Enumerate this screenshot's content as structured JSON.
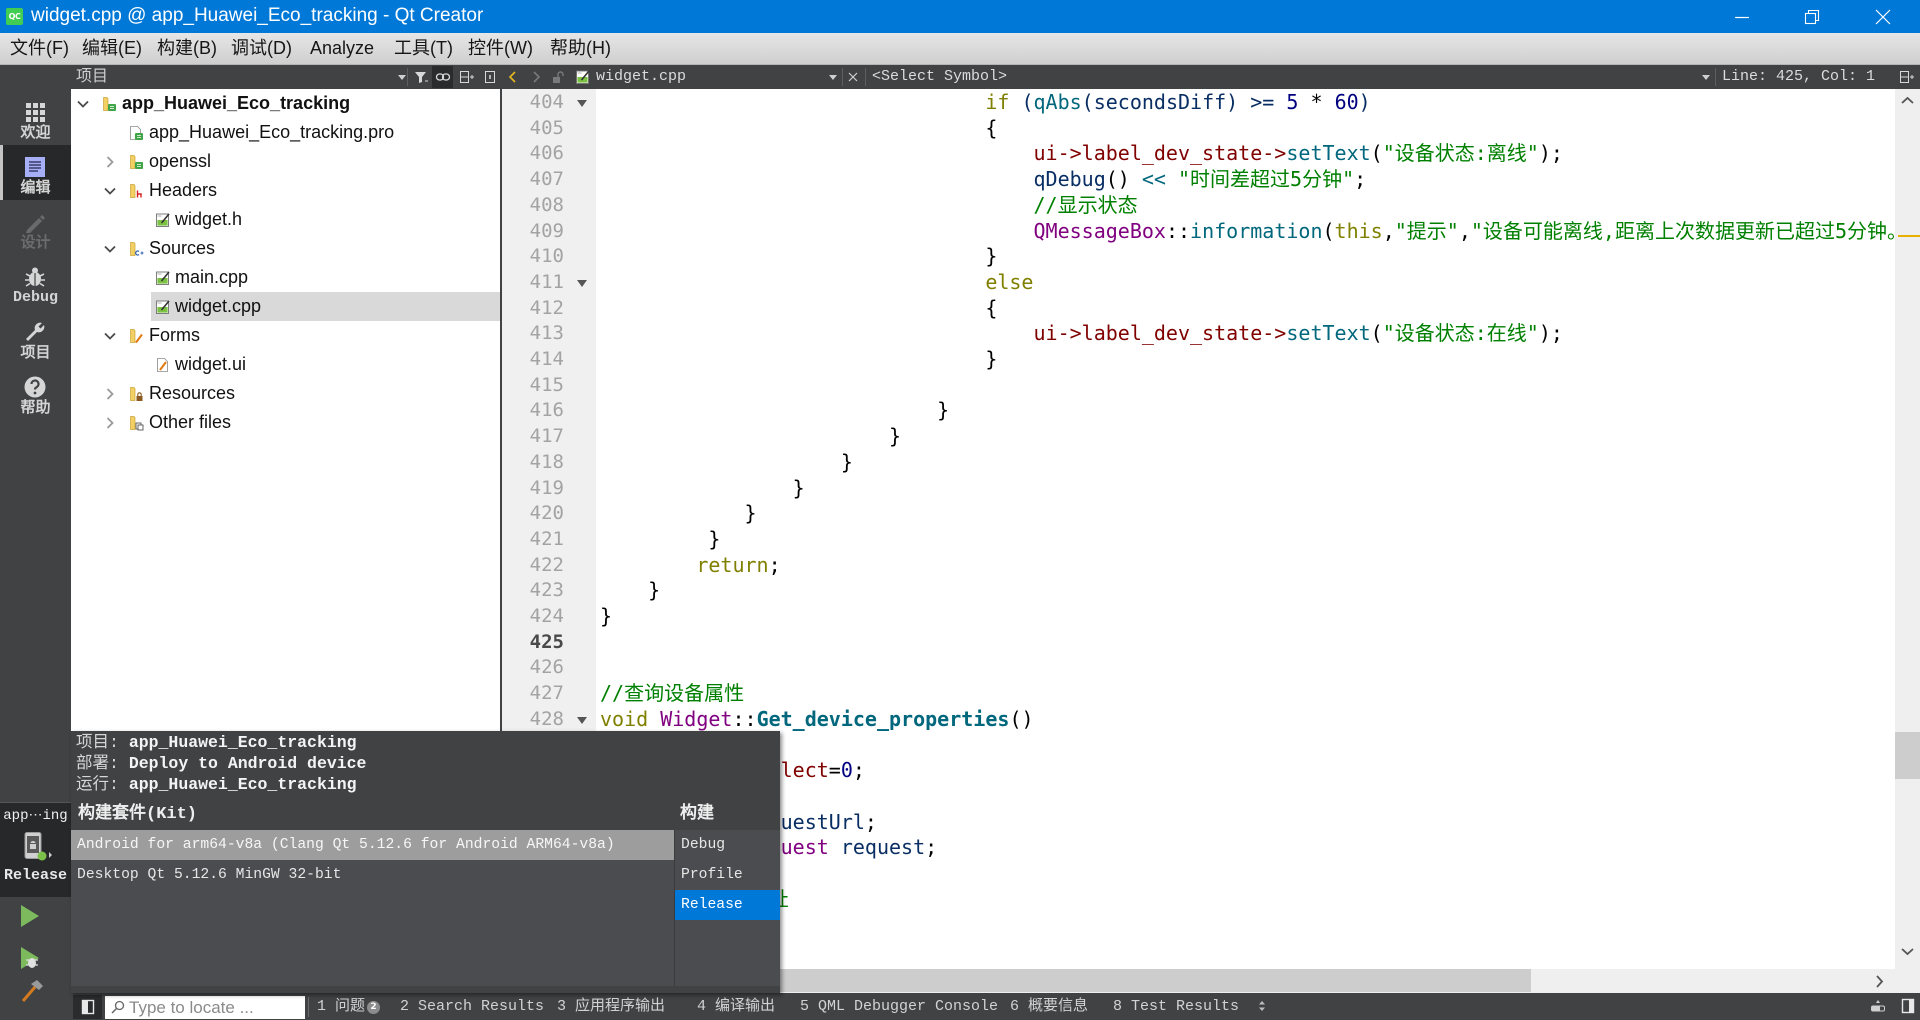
{
  "colors": {
    "accent": "#0078d7",
    "panel_dark": "#404244",
    "mode_selected": "#262829",
    "tree_selection": "#d9d9d9",
    "kit_selection": "#9d9d9d",
    "run_green": "#7cba5d",
    "scroll_marker": "#e8b000"
  },
  "syntax_colors": {
    "keyword": "#808000",
    "number": "#000080",
    "string": "#008000",
    "comment": "#008000",
    "function": "#00677c",
    "local": "#092e64",
    "field": "#800000",
    "type": "#800080",
    "punct": "#000000"
  },
  "window": {
    "title": "widget.cpp @ app_Huawei_Eco_tracking - Qt Creator",
    "app_icon_text": "QC"
  },
  "menu": [
    "文件(F)",
    "编辑(E)",
    "构建(B)",
    "调试(D)",
    "Analyze",
    "工具(T)",
    "控件(W)",
    "帮助(H)"
  ],
  "mode_bar": {
    "items": [
      {
        "label": "欢迎",
        "icon": "welcome-grid-icon"
      },
      {
        "label": "编辑",
        "icon": "edit-document-icon",
        "selected": true
      },
      {
        "label": "设计",
        "icon": "design-pencil-icon",
        "disabled": true
      },
      {
        "label": "Debug",
        "icon": "debug-bug-icon"
      },
      {
        "label": "项目",
        "icon": "projects-wrench-icon"
      },
      {
        "label": "帮助",
        "icon": "help-question-icon"
      }
    ],
    "kit_selector": {
      "project": "app⋯ing",
      "build": "Release",
      "icon": "android-device-icon"
    },
    "actions": [
      "run",
      "start-debugging",
      "build"
    ]
  },
  "project_pane": {
    "title": "项目",
    "tree": [
      {
        "label": "app_Huawei_Eco_tracking",
        "level": 0,
        "expander": "expanded",
        "icon": "qt-project-folder-icon",
        "bold": true
      },
      {
        "label": "app_Huawei_Eco_tracking.pro",
        "level": 1,
        "expander": null,
        "icon": "pro-file-icon"
      },
      {
        "label": "openssl",
        "level": 1,
        "expander": "collapsed",
        "icon": "qt-project-folder-icon"
      },
      {
        "label": "Headers",
        "level": 1,
        "expander": "expanded",
        "icon": "headers-folder-icon"
      },
      {
        "label": "widget.h",
        "level": 2,
        "expander": null,
        "icon": "source-file-icon"
      },
      {
        "label": "Sources",
        "level": 1,
        "expander": "expanded",
        "icon": "sources-folder-icon"
      },
      {
        "label": "main.cpp",
        "level": 2,
        "expander": null,
        "icon": "source-file-icon"
      },
      {
        "label": "widget.cpp",
        "level": 2,
        "expander": null,
        "icon": "source-file-icon",
        "selected": true
      },
      {
        "label": "Forms",
        "level": 1,
        "expander": "expanded",
        "icon": "forms-folder-icon"
      },
      {
        "label": "widget.ui",
        "level": 2,
        "expander": null,
        "icon": "ui-file-icon"
      },
      {
        "label": "Resources",
        "level": 1,
        "expander": "collapsed",
        "icon": "resources-folder-icon"
      },
      {
        "label": "Other files",
        "level": 1,
        "expander": "collapsed",
        "icon": "other-files-folder-icon"
      }
    ]
  },
  "editor": {
    "file_name": "widget.cpp",
    "symbol": "<Select Symbol>",
    "position": "Line: 425, Col: 1",
    "current_line": "425",
    "lines": [
      {
        "n": "404",
        "fold": true,
        "indent": 32,
        "tokens": [
          [
            "if",
            "keyword"
          ],
          [
            " ",
            "punct"
          ],
          [
            "(",
            "local"
          ],
          [
            "qAbs",
            "function"
          ],
          [
            "(",
            "local"
          ],
          [
            "secondsDiff",
            "local"
          ],
          [
            ")",
            "local"
          ],
          [
            " >= ",
            "local"
          ],
          [
            "5",
            "number"
          ],
          [
            " * ",
            "punct"
          ],
          [
            "60",
            "number"
          ],
          [
            ")",
            "local"
          ]
        ]
      },
      {
        "n": "405",
        "indent": 32,
        "tokens": [
          [
            "{",
            "punct"
          ]
        ]
      },
      {
        "n": "406",
        "indent": 36,
        "tokens": [
          [
            "ui->label_dev_state->",
            "field"
          ],
          [
            "setText",
            "function"
          ],
          [
            "(",
            "punct"
          ],
          [
            "\"设备状态:离线\"",
            "string"
          ],
          [
            ");",
            "punct"
          ]
        ]
      },
      {
        "n": "407",
        "indent": 36,
        "tokens": [
          [
            "qDebug",
            "local"
          ],
          [
            "()",
            "punct"
          ],
          [
            " ",
            "punct"
          ],
          [
            "<<",
            "operator"
          ],
          [
            " ",
            "punct"
          ],
          [
            "\"时间差超过5分钟\"",
            "string"
          ],
          [
            ";",
            "punct"
          ]
        ]
      },
      {
        "n": "408",
        "indent": 36,
        "tokens": [
          [
            "//显示状态",
            "comment"
          ]
        ]
      },
      {
        "n": "409",
        "indent": 36,
        "tokens": [
          [
            "QMessageBox",
            "type"
          ],
          [
            "::",
            "punct"
          ],
          [
            "information",
            "function"
          ],
          [
            "(",
            "punct"
          ],
          [
            "this",
            "keyword"
          ],
          [
            ",",
            "punct"
          ],
          [
            "\"提示\"",
            "string"
          ],
          [
            ",",
            "punct"
          ],
          [
            "\"设备可能离线,距离上次数据更新已超过5分钟。",
            "string"
          ]
        ]
      },
      {
        "n": "410",
        "indent": 32,
        "tokens": [
          [
            "}",
            "punct"
          ]
        ]
      },
      {
        "n": "411",
        "fold": true,
        "indent": 32,
        "tokens": [
          [
            "else",
            "keyword"
          ]
        ]
      },
      {
        "n": "412",
        "indent": 32,
        "tokens": [
          [
            "{",
            "punct"
          ]
        ]
      },
      {
        "n": "413",
        "indent": 36,
        "tokens": [
          [
            "ui->label_dev_state->",
            "field"
          ],
          [
            "setText",
            "function"
          ],
          [
            "(",
            "punct"
          ],
          [
            "\"设备状态:在线\"",
            "string"
          ],
          [
            ");",
            "punct"
          ]
        ]
      },
      {
        "n": "414",
        "indent": 32,
        "tokens": [
          [
            "}",
            "punct"
          ]
        ]
      },
      {
        "n": "415",
        "indent": 0,
        "tokens": []
      },
      {
        "n": "416",
        "indent": 28,
        "tokens": [
          [
            "}",
            "punct"
          ]
        ]
      },
      {
        "n": "417",
        "indent": 24,
        "tokens": [
          [
            "}",
            "punct"
          ]
        ]
      },
      {
        "n": "418",
        "indent": 20,
        "tokens": [
          [
            "}",
            "punct"
          ]
        ]
      },
      {
        "n": "419",
        "indent": 16,
        "tokens": [
          [
            "}",
            "punct"
          ]
        ]
      },
      {
        "n": "420",
        "indent": 12,
        "tokens": [
          [
            "}",
            "punct"
          ]
        ]
      },
      {
        "n": "421",
        "indent": 9,
        "tokens": [
          [
            "}",
            "punct"
          ]
        ]
      },
      {
        "n": "422",
        "indent": 8,
        "tokens": [
          [
            "return",
            "keyword"
          ],
          [
            ";",
            "punct"
          ]
        ]
      },
      {
        "n": "423",
        "indent": 4,
        "tokens": [
          [
            "}",
            "punct"
          ]
        ]
      },
      {
        "n": "424",
        "indent": 0,
        "tokens": [
          [
            "}",
            "punct"
          ]
        ]
      },
      {
        "n": "425",
        "indent": 0,
        "tokens": []
      },
      {
        "n": "426",
        "indent": 0,
        "tokens": []
      },
      {
        "n": "427",
        "indent": 0,
        "tokens": [
          [
            "//查询设备属性",
            "comment"
          ]
        ]
      },
      {
        "n": "428",
        "fold": true,
        "indent": 0,
        "tokens": [
          [
            "void",
            "keyword"
          ],
          [
            " ",
            "punct"
          ],
          [
            "Widget",
            "type"
          ],
          [
            "::",
            "punct"
          ],
          [
            "Get_device_properties",
            "function-decl"
          ],
          [
            "()",
            "punct"
          ]
        ]
      },
      {
        "n": null,
        "indent": 0,
        "tokens": []
      },
      {
        "n": null,
        "indent": 15,
        "tokens": [
          [
            "lect",
            "field"
          ],
          [
            "=",
            "punct"
          ],
          [
            "0",
            "number"
          ],
          [
            ";",
            "punct"
          ]
        ]
      },
      {
        "n": null,
        "indent": 0,
        "tokens": []
      },
      {
        "n": null,
        "indent": 15,
        "tokens": [
          [
            "uestUrl",
            "local"
          ],
          [
            ";",
            "punct"
          ]
        ]
      },
      {
        "n": null,
        "indent": 15,
        "tokens": [
          [
            "uest",
            "type"
          ],
          [
            " ",
            "punct"
          ],
          [
            "request",
            "local"
          ],
          [
            ";",
            "punct"
          ]
        ]
      },
      {
        "n": null,
        "indent": 0,
        "tokens": []
      },
      {
        "n": null,
        "indent": 14,
        "tokens": [
          [
            "址",
            "comment"
          ]
        ]
      }
    ]
  },
  "popup": {
    "project_label": "项目: ",
    "project_value": "app_Huawei_Eco_tracking",
    "deploy_label": "部署: ",
    "deploy_value": "Deploy to Android device",
    "run_label": "运行: ",
    "run_value": "app_Huawei_Eco_tracking",
    "kit_header": "构建套件(Kit)",
    "build_header": "构建",
    "kits": [
      {
        "label": "Android for arm64-v8a (Clang Qt 5.12.6 for Android ARM64-v8a)",
        "selected": true
      },
      {
        "label": "Desktop Qt 5.12.6 MinGW 32-bit",
        "selected": false
      }
    ],
    "builds": [
      {
        "label": "Debug",
        "selected": false
      },
      {
        "label": "Profile",
        "selected": false
      },
      {
        "label": "Release",
        "selected": true
      }
    ]
  },
  "status_bar": {
    "search_placeholder": "Type to locate ...",
    "tabs": [
      {
        "label": "1 问题",
        "badge": "2"
      },
      {
        "label": "2 Search Results"
      },
      {
        "label": "3 应用程序输出"
      },
      {
        "label": "4 编译输出"
      },
      {
        "label": "5 QML Debugger Console"
      },
      {
        "label": "6 概要信息"
      },
      {
        "label": "8 Test Results"
      }
    ]
  }
}
